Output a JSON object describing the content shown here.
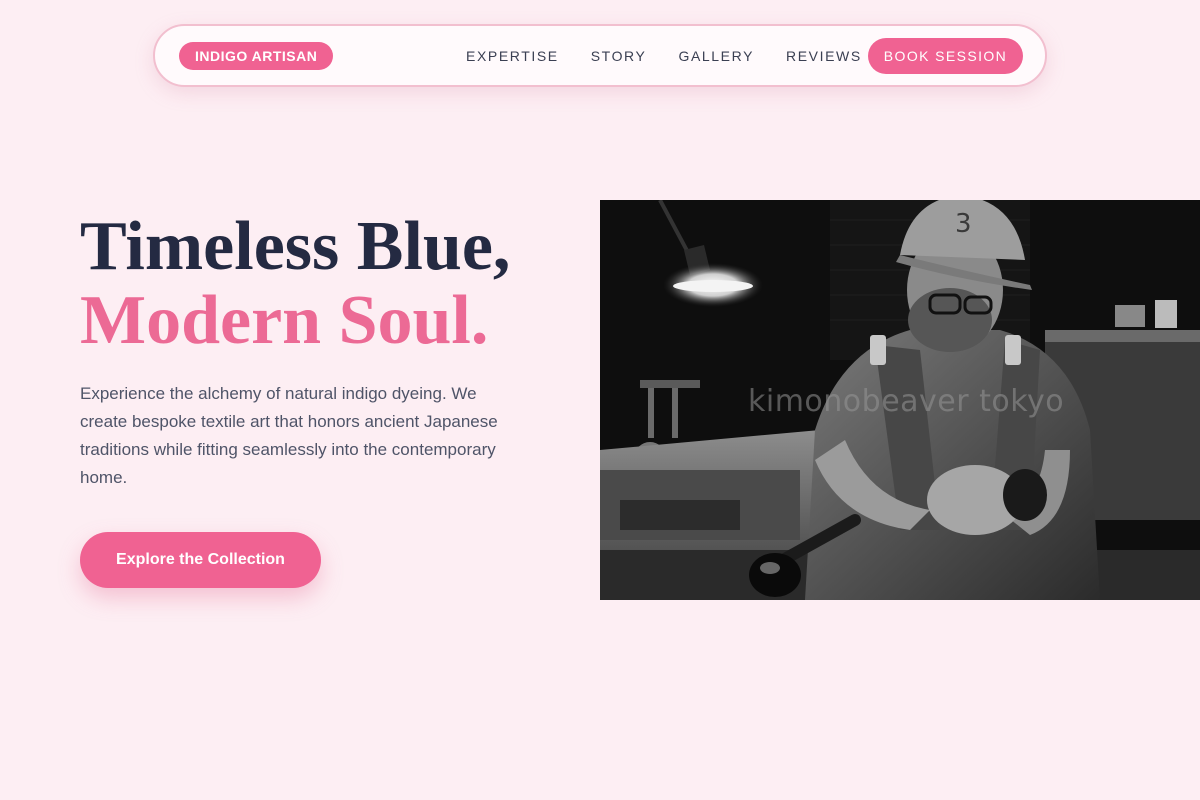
{
  "nav": {
    "brand": "INDIGO ARTISAN",
    "links": [
      "EXPERTISE",
      "STORY",
      "GALLERY",
      "REVIEWS"
    ],
    "cta": "BOOK SESSION"
  },
  "hero": {
    "headline_line1": "Timeless Blue,",
    "headline_line2": "Modern Soul.",
    "description": "Experience the alchemy of natural indigo dyeing. We create bespoke textile art that honors ancient Japanese traditions while fitting seamlessly into the contemporary home.",
    "cta": "Explore the Collection",
    "image_watermark": "kimonobeaver tokyo"
  },
  "colors": {
    "background": "#fdeef3",
    "accent": "#f06292",
    "headline_dark": "#242a42",
    "headline_pink": "#ec6a95"
  }
}
